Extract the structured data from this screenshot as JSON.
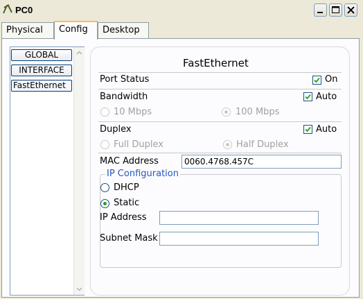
{
  "window": {
    "title": "PC0"
  },
  "tabs": [
    {
      "label": "Physical"
    },
    {
      "label": "Config"
    },
    {
      "label": "Desktop"
    }
  ],
  "sidebar": {
    "items": [
      {
        "label": "GLOBAL"
      },
      {
        "label": "INTERFACE"
      },
      {
        "label": "FastEthernet"
      }
    ]
  },
  "content": {
    "heading": "FastEthernet",
    "port_status": {
      "label": "Port Status",
      "checked": true,
      "checkbox_label": "On"
    },
    "bandwidth": {
      "label": "Bandwidth",
      "auto_checked": true,
      "auto_label": "Auto",
      "options": [
        "10 Mbps",
        "100 Mbps"
      ],
      "selected": "100 Mbps"
    },
    "duplex": {
      "label": "Duplex",
      "auto_checked": true,
      "auto_label": "Auto",
      "options": [
        "Full Duplex",
        "Half Duplex"
      ],
      "selected": "Half Duplex"
    },
    "mac_address": {
      "label": "MAC Address",
      "value": "0060.4768.457C"
    },
    "ip_configuration": {
      "title": "IP Configuration",
      "dhcp_label": "DHCP",
      "static_label": "Static",
      "mode": "Static",
      "ip_address": {
        "label": "IP Address",
        "value": ""
      },
      "subnet_mask": {
        "label": "Subnet Mask",
        "value": ""
      }
    }
  },
  "colors": {
    "accent_tab": "#f7c05a",
    "radio_selected": "#21a121",
    "section_title": "#2457c2",
    "border": "#7f9db9"
  }
}
